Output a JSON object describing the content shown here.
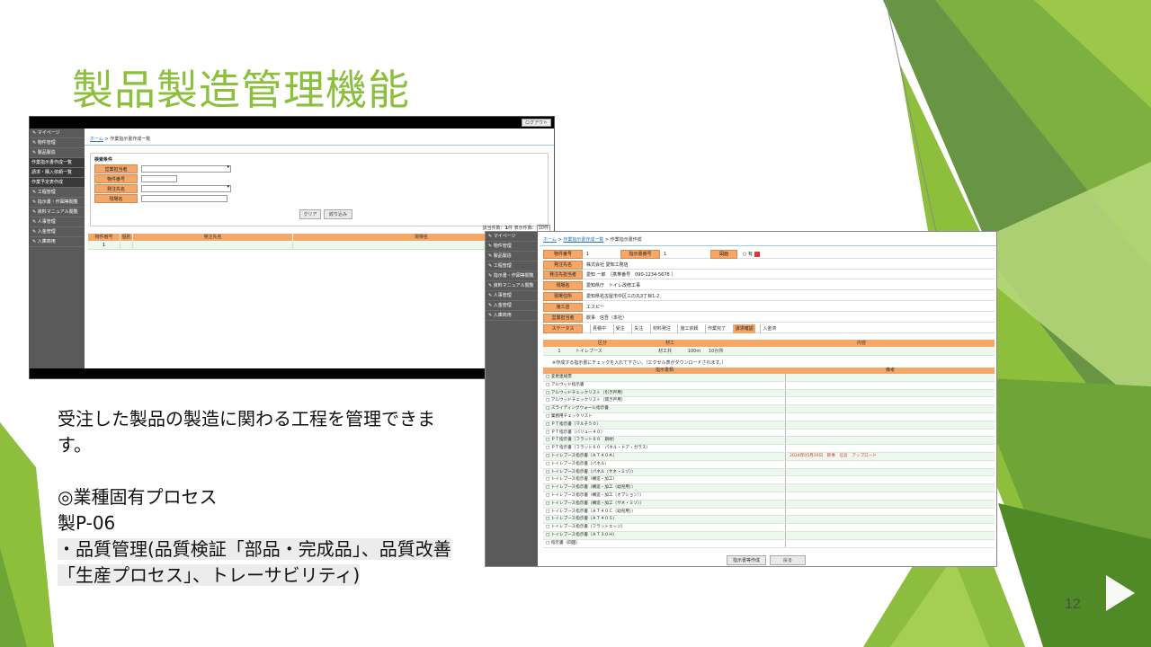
{
  "slide": {
    "title": "製品製造管理機能",
    "page_number": "12",
    "body": {
      "line1": "受注した製品の製造に関わる工程を管理できます。",
      "line2": "◎業種固有プロセス",
      "line3": "製P-06",
      "line4": "・品質管理(品質検証「部品・完成品」、品質改善「生産プロセス」、トレーサビリティ)"
    }
  },
  "colors": {
    "title_green": "#8bbf3c",
    "header_orange": "#f5a768",
    "sidebar_gray": "#5a5a5a",
    "row_green": "#eef7ee",
    "link_blue": "#2a6fc0",
    "alert_red": "#d43c2b"
  },
  "screen1": {
    "logout": "ログアウト",
    "sidebar": [
      {
        "label": "マイページ",
        "icon": "pencil-icon",
        "sub": false
      },
      {
        "label": "物件管理",
        "icon": "pencil-icon",
        "sub": false
      },
      {
        "label": "製品製造",
        "icon": "pencil-icon",
        "sub": false
      },
      {
        "label": "作業指示書作成一覧",
        "icon": "",
        "sub": true
      },
      {
        "label": "請求・購入依頼一覧",
        "icon": "",
        "sub": true
      },
      {
        "label": "作業予定表作成",
        "icon": "",
        "sub": true
      },
      {
        "label": "工程管理",
        "icon": "pencil-icon",
        "sub": false
      },
      {
        "label": "指示書・作図等閲覧",
        "icon": "pencil-icon",
        "sub": false
      },
      {
        "label": "資料マニュアル閲覧",
        "icon": "pencil-icon",
        "sub": false
      },
      {
        "label": "人事管理",
        "icon": "pencil-icon",
        "sub": false
      },
      {
        "label": "入金管理",
        "icon": "pencil-icon",
        "sub": false
      },
      {
        "label": "入庫商用",
        "icon": "pencil-icon",
        "sub": false
      }
    ],
    "breadcrumb": {
      "home": "ホーム",
      "sep": ">",
      "current": "作業指示書作成一覧"
    },
    "search": {
      "heading": "検索条件",
      "fields": [
        {
          "label": "営業担当者",
          "value": ""
        },
        {
          "label": "物件番号",
          "value": ""
        },
        {
          "label": "発注先名",
          "value": ""
        },
        {
          "label": "現場名",
          "value": ""
        }
      ],
      "clear_label": "クリア",
      "filter_label": "絞り込み"
    },
    "count_text": "該当件数：",
    "count_value": "1",
    "count_unit": "件",
    "per_page_label": "表示件数：",
    "per_page_value": "10件",
    "table": {
      "headers": [
        "物件番号",
        "個別",
        "発注先名",
        "現場名"
      ],
      "rows": [
        [
          "1",
          "",
          "",
          ""
        ]
      ]
    }
  },
  "screen2": {
    "sidebar": [
      "マイページ",
      "物件管理",
      "製品製造",
      "工程管理",
      "指示書・作図等閲覧",
      "資料マニュアル閲覧",
      "人事管理",
      "入金管理",
      "入庫商用"
    ],
    "breadcrumb": {
      "home": "ホーム",
      "sep": ">",
      "mid": "作業指示書作成一覧",
      "current": "作業指示書作成"
    },
    "details": {
      "property_no_label": "物件番号",
      "property_no": "1",
      "instruction_no_label": "指示書番号",
      "instruction_no": "1",
      "drawing_label": "図面",
      "drawing_value": "有",
      "client_label": "発注先名",
      "client": "株式会社 愛知工務店",
      "contact_label": "発注先担当者",
      "contact": "愛知 一郎　［携帯番号　090-1234-5678 ］",
      "site_label": "現場名",
      "site": "愛知県庁　トイレ改修工事",
      "site_address_label": "現場住所",
      "site_address": "愛知県名古屋市中区三の丸3丁目1-2",
      "contractor_label": "施工店",
      "contractor": "エスピー",
      "sales_label": "営業担当者",
      "sales": "飲事　信吾（本社）",
      "status_label": "ステータス",
      "statuses": [
        "見積中",
        "受注",
        "失注",
        "材料発注",
        "施工依頼",
        "作業完了",
        "請求確認",
        "入金済"
      ],
      "active_status": "請求確認"
    },
    "work_table": {
      "headers": [
        "",
        "区分",
        "材工",
        "",
        "内容"
      ],
      "rows": [
        [
          "1",
          "トイレブース",
          "材工共",
          "100m",
          "10か所"
        ]
      ]
    },
    "note": "※作成する指示書にチェックを入れて下さい。（エクセル表がダウンロードされます。）",
    "instruction_table": {
      "headers": [
        "指示書類",
        "備考"
      ],
      "rows": [
        {
          "name": "変更連絡票",
          "remark": ""
        },
        {
          "name": "アルウッド指示書",
          "remark": ""
        },
        {
          "name": "アルウッドチェックリスト（引き戸用）",
          "remark": ""
        },
        {
          "name": "アルウッドチェックリスト（開き戸用）",
          "remark": ""
        },
        {
          "name": "スライディングウォール指示書",
          "remark": ""
        },
        {
          "name": "業務用チェックリスト",
          "remark": ""
        },
        {
          "name": "ＰＴ指示書（マルチ５０）",
          "remark": ""
        },
        {
          "name": "ＰＴ指示書（バリュー４０）",
          "remark": ""
        },
        {
          "name": "ＰＴ指示書（フラット６０　鋼材）",
          "remark": ""
        },
        {
          "name": "ＰＴ指示書（フラット６０　パネル・ドア・ガラス）",
          "remark": ""
        },
        {
          "name": "トイレブース指示書（ＡＴ４０Ａ）",
          "remark": "2024年05月29日　飲事　信吾　アップロード"
        },
        {
          "name": "トイレブース指示書（パネル）",
          "remark": ""
        },
        {
          "name": "トイレブース指示書（パネル（サネ・ミゾ））",
          "remark": ""
        },
        {
          "name": "トイレブース指示書（構造・加工）",
          "remark": ""
        },
        {
          "name": "トイレブース指示書（構造・加工（幼児用））",
          "remark": ""
        },
        {
          "name": "トイレブース指示書（構造・加工（オプション））",
          "remark": ""
        },
        {
          "name": "トイレブース指示書（構造・加工（サネ・ミゾ））",
          "remark": ""
        },
        {
          "name": "トイレブース指示書（ＡＴ４０Ｃ（幼児用））",
          "remark": ""
        },
        {
          "name": "トイレブース指示書（ＡＴ４０Ｓ）",
          "remark": ""
        },
        {
          "name": "トイレブース指示書（フラットエッジ）",
          "remark": ""
        },
        {
          "name": "トイレブース指示書（ＡＴ３０Ｈ）",
          "remark": ""
        },
        {
          "name": "指示書（四国）",
          "remark": ""
        }
      ]
    },
    "create_label": "指示書等作成",
    "back_label": "戻る"
  }
}
